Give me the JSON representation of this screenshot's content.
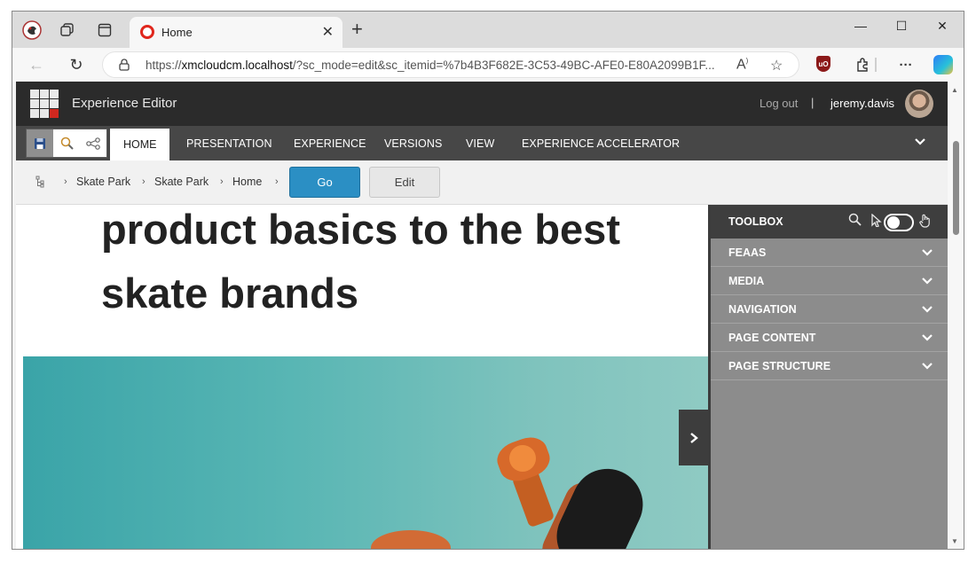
{
  "browser": {
    "tab_title": "Home",
    "new_tab_glyph": "+",
    "url_prefix": "https://",
    "url_host": "xmcloudcm.localhost",
    "url_rest": "/?sc_mode=edit&sc_itemid=%7b4B3F682E-3C53-49BC-AFE0-E80A2099B1F..."
  },
  "editor": {
    "title": "Experience Editor",
    "logout": "Log out",
    "separator": "|",
    "username": "jeremy.davis"
  },
  "ribbon": {
    "tabs": [
      "HOME",
      "PRESENTATION",
      "EXPERIENCE",
      "VERSIONS",
      "VIEW",
      "EXPERIENCE ACCELERATOR"
    ]
  },
  "breadcrumb": {
    "items": [
      "Skate Park",
      "Skate Park",
      "Home"
    ],
    "go_label": "Go",
    "edit_label": "Edit"
  },
  "page": {
    "headline_line1": "product basics to the best",
    "headline_line2": "skate brands"
  },
  "toolbox": {
    "title": "TOOLBOX",
    "sections": [
      "FEAAS",
      "MEDIA",
      "NAVIGATION",
      "PAGE CONTENT",
      "PAGE STRUCTURE"
    ]
  },
  "colors": {
    "go_button": "#2b8fc4",
    "header_bg": "#2b2b2b",
    "ribbon_bg": "#474747",
    "toolbox_bg": "#8c8c8c",
    "hero_teal": "#59b6b4"
  }
}
